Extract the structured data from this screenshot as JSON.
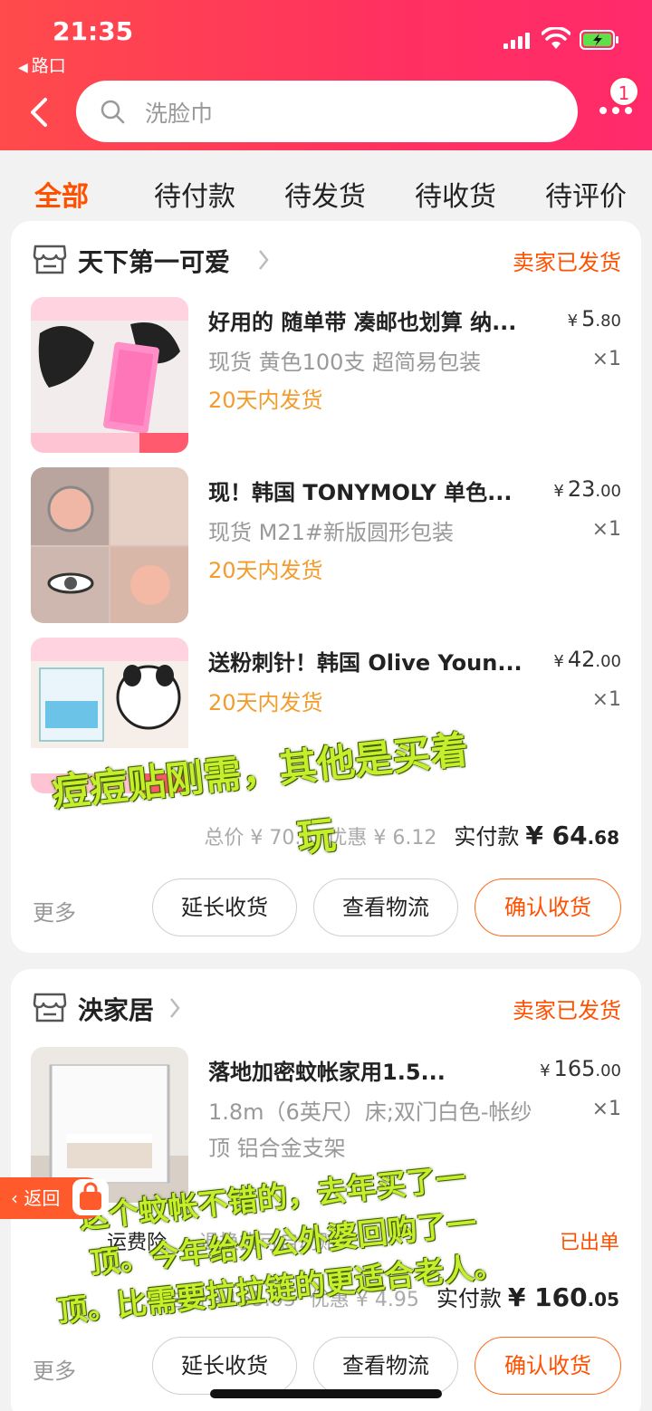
{
  "status_bar": {
    "time": "21:35",
    "back_app": "路口"
  },
  "search": {
    "placeholder": "洗脸巾",
    "badge_count": "1"
  },
  "tabs": [
    {
      "label": "全部",
      "active": true
    },
    {
      "label": "待付款"
    },
    {
      "label": "待发货"
    },
    {
      "label": "待收货"
    },
    {
      "label": "待评价"
    }
  ],
  "orders": [
    {
      "shop": "天下第一可爱",
      "status": "卖家已发货",
      "items": [
        {
          "title": "好用的 随单带 凑邮也划算 纳...",
          "price_int": "5",
          "price_dec": ".80",
          "spec": "现货  黄色100支 超简易包装",
          "qty": "×1",
          "ship_note": "20天内发货"
        },
        {
          "title": "现！韩国 TONYMOLY 单色...",
          "price_int": "23",
          "price_dec": ".00",
          "spec": "现货 M21#新版圆形包装",
          "qty": "×1",
          "ship_note": "20天内发货"
        },
        {
          "title": "送粉刺针！韩国 Olive Youn...",
          "price_int": "42",
          "price_dec": ".00",
          "spec": "",
          "qty": "×1",
          "ship_note": "20天内发货"
        }
      ],
      "total_label": "总价",
      "total": "¥ 70.8",
      "discount_label": "优惠",
      "discount": "¥ 6.12",
      "paid_label": "实付款",
      "paid_int": "¥ 64",
      "paid_dec": ".68",
      "actions": {
        "more": "更多",
        "extend": "延长收货",
        "logistics": "查看物流",
        "confirm": "确认收货"
      }
    },
    {
      "shop": "泱家居",
      "status": "卖家已发货",
      "items": [
        {
          "title": "落地加密蚊帐家用1.5...",
          "price_int": "165",
          "price_dec": ".00",
          "spec": "1.8m（6英尺）床;双门白色-帐纱顶 铝合金支架",
          "qty": "×1"
        }
      ],
      "insurance": "运费险",
      "insurance_note": "退换货可自动赔",
      "insurance_status": "已出单",
      "total_label": "总价",
      "total": "¥165.05",
      "discount_label": "优惠",
      "discount": "¥ 4.95",
      "paid_label": "实付款",
      "paid_int": "¥ 160",
      "paid_dec": ".05",
      "actions": {
        "more": "更多",
        "extend": "延长收货",
        "logistics": "查看物流",
        "confirm": "确认收货"
      }
    }
  ],
  "overlay_notes": [
    "痘痘贴刚需，其他是买着",
    "玩",
    "这个蚊帐不错的，去年买了一",
    "顶。今年给外公外婆回购了一",
    "顶。比需要拉拉链的更适合老人。"
  ],
  "float_back": "返回",
  "colors": {
    "accent": "#ff5000",
    "header": "#ff3160",
    "ship_note": "#f39c2c",
    "overlay": "#c5ef2a"
  }
}
